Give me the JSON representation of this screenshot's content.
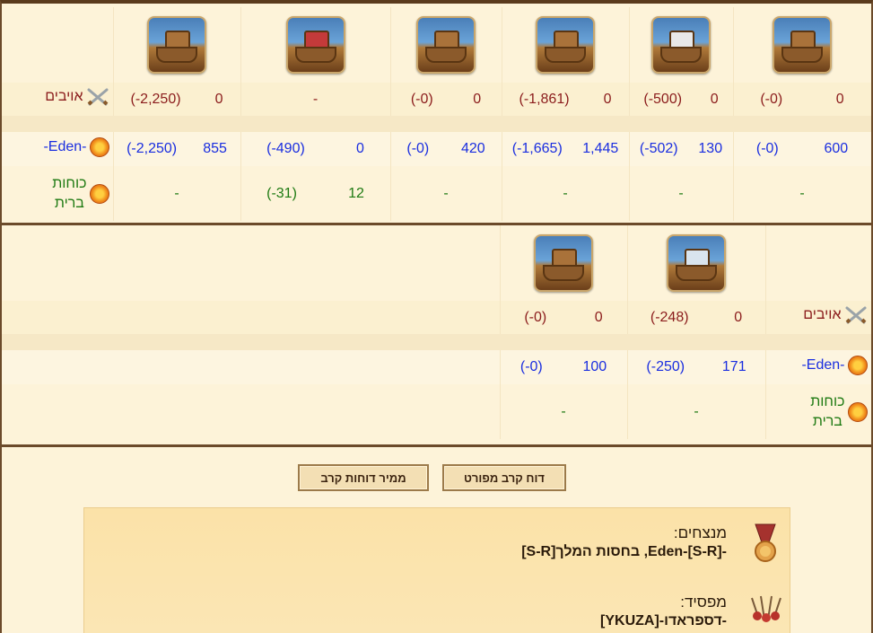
{
  "labels": {
    "enemies": "אויבים",
    "own": "-Eden-",
    "allies_line1": "כוחות",
    "allies_line2": "ברית"
  },
  "top_block": {
    "units": [
      "fire-ship",
      "ram-ship-red",
      "paddle-steamer",
      "catapult-ship",
      "mortar-ship-target",
      "ballista-ship"
    ],
    "enemies": [
      {
        "count": "0",
        "loss": "(2,250-)"
      },
      {
        "dash": "-"
      },
      {
        "count": "0",
        "loss": "(0-)"
      },
      {
        "count": "0",
        "loss": "(1,861-)"
      },
      {
        "count": "0",
        "loss": "(500-)"
      },
      {
        "count": "0",
        "loss": "(0-)"
      }
    ],
    "own": [
      {
        "count": "855",
        "loss": "(2,250-)"
      },
      {
        "count": "0",
        "loss": "(490-)"
      },
      {
        "count": "420",
        "loss": "(0-)"
      },
      {
        "count": "1,445",
        "loss": "(1,665-)"
      },
      {
        "count": "130",
        "loss": "(502-)"
      },
      {
        "count": "600",
        "loss": "(0-)"
      }
    ],
    "allies": [
      {
        "dash": "-"
      },
      {
        "count": "12",
        "loss": "(31-)"
      },
      {
        "dash": "-"
      },
      {
        "dash": "-"
      },
      {
        "dash": "-"
      },
      {
        "dash": "-"
      }
    ]
  },
  "bottom_block": {
    "units": [
      "diving-boat",
      "rocket-ship"
    ],
    "enemies": [
      {
        "count": "0",
        "loss": "(248-)"
      },
      {
        "count": "0",
        "loss": "(0-)"
      }
    ],
    "own": [
      {
        "count": "171",
        "loss": "(250-)"
      },
      {
        "count": "100",
        "loss": "(0-)"
      }
    ],
    "allies": [
      {
        "dash": "-"
      },
      {
        "dash": "-"
      }
    ]
  },
  "buttons": {
    "detailed_report": "דוח קרב מפורט",
    "report_converter": "ממיר דוחות קרב"
  },
  "summary": {
    "winners_title": "מנצחים:",
    "winners_value": "-Eden-[S-R], בחסות המלך[S-R]",
    "loser_title": "מפסיד:",
    "loser_value": "-דספראדו-[YKUZA]"
  }
}
